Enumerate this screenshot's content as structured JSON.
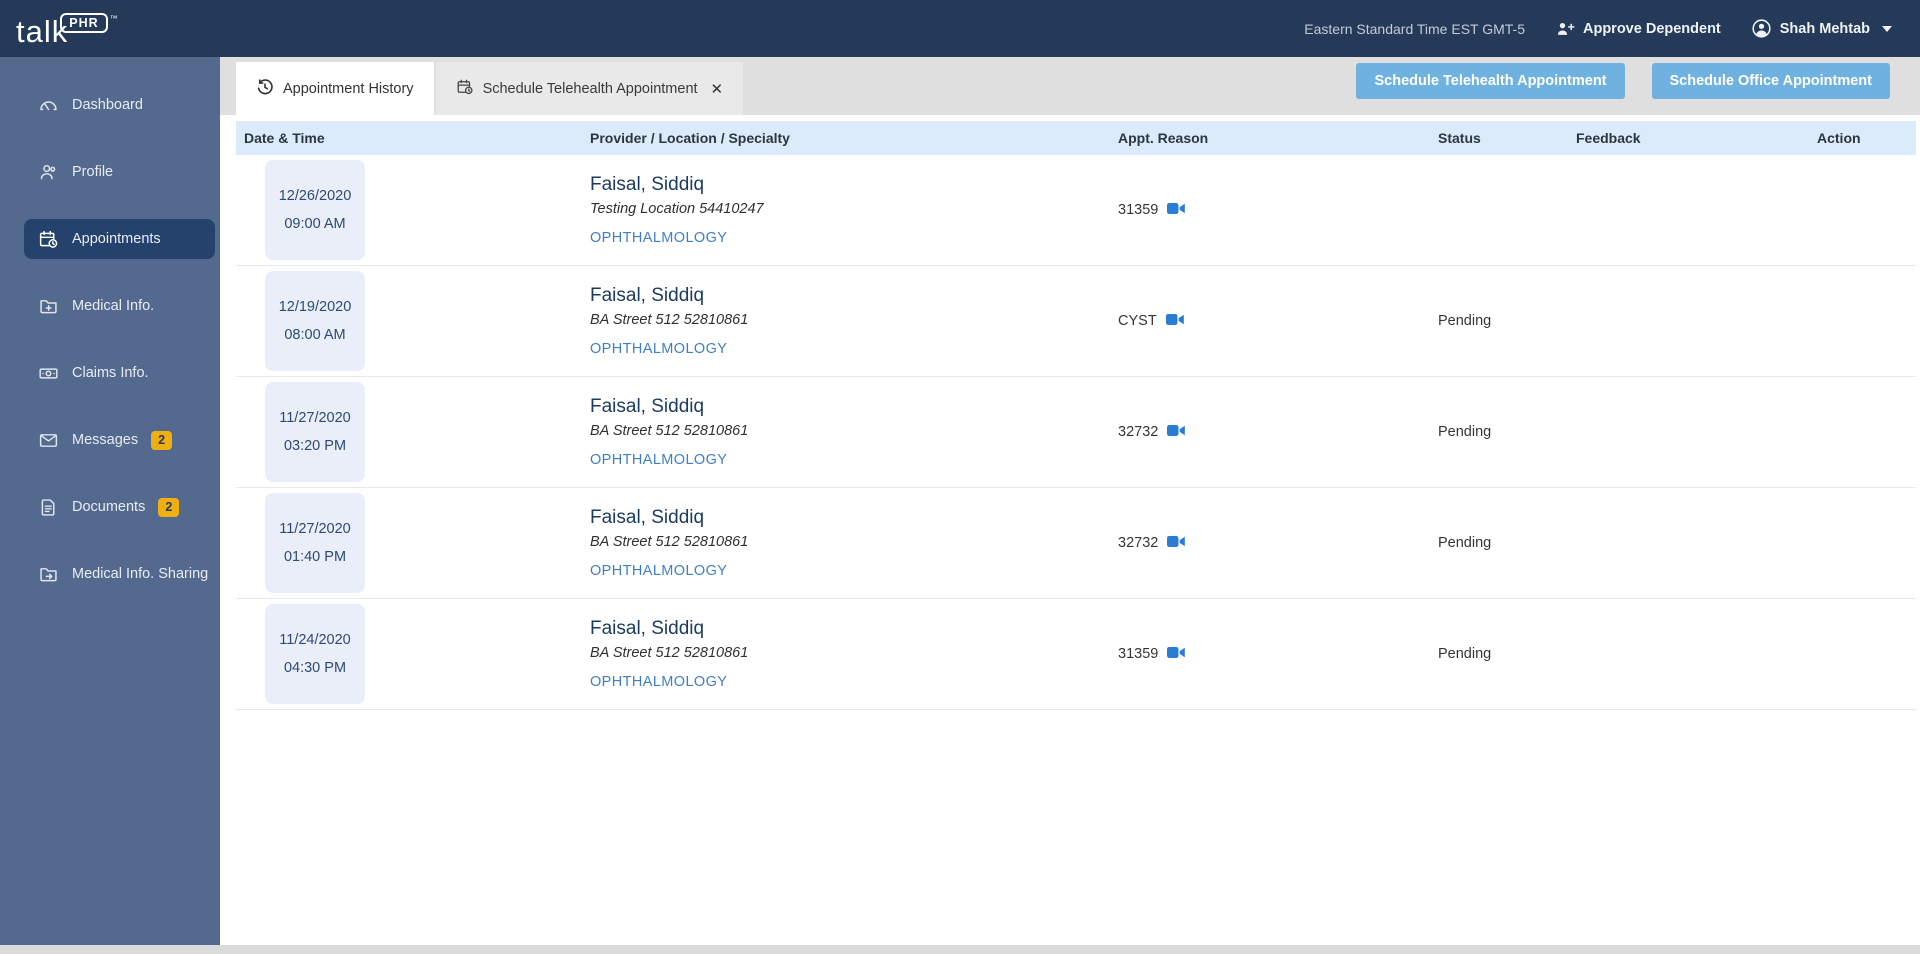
{
  "brand": {
    "name": "talk",
    "badge": "PHR",
    "tm": "™"
  },
  "topbar": {
    "timezone": "Eastern Standard Time EST GMT-5",
    "approve_dependent": "Approve Dependent",
    "user_name": "Shah Mehtab"
  },
  "sidebar": {
    "items": [
      {
        "label": "Dashboard",
        "icon": "dashboard-icon",
        "active": false
      },
      {
        "label": "Profile",
        "icon": "profile-icon",
        "active": false
      },
      {
        "label": "Appointments",
        "icon": "appointments-icon",
        "active": true
      },
      {
        "label": "Medical Info.",
        "icon": "medical-info-icon",
        "active": false
      },
      {
        "label": "Claims Info.",
        "icon": "claims-icon",
        "active": false
      },
      {
        "label": "Messages",
        "icon": "messages-icon",
        "active": false,
        "badge": "2"
      },
      {
        "label": "Documents",
        "icon": "documents-icon",
        "active": false,
        "badge": "2"
      },
      {
        "label": "Medical Info. Sharing",
        "icon": "sharing-icon",
        "active": false
      }
    ]
  },
  "tabs": {
    "history_label": "Appointment History",
    "schedule_label": "Schedule Telehealth Appointment",
    "close_glyph": "✕"
  },
  "actions": {
    "schedule_telehealth": "Schedule Telehealth Appointment",
    "schedule_office": "Schedule Office Appointment"
  },
  "table": {
    "headers": {
      "date": "Date & Time",
      "provider": "Provider / Location / Specialty",
      "reason": "Appt. Reason",
      "status": "Status",
      "feedback": "Feedback",
      "action": "Action"
    },
    "rows": [
      {
        "date": "12/26/2020",
        "time": "09:00 AM",
        "provider": "Faisal, Siddiq",
        "location": "Testing Location 54410247",
        "specialty": "OPHTHALMOLOGY",
        "reason": "31359",
        "status": "",
        "feedback": "",
        "action": ""
      },
      {
        "date": "12/19/2020",
        "time": "08:00 AM",
        "provider": "Faisal, Siddiq",
        "location": "BA Street 512 52810861",
        "specialty": "OPHTHALMOLOGY",
        "reason": "CYST",
        "status": "Pending",
        "feedback": "",
        "action": ""
      },
      {
        "date": "11/27/2020",
        "time": "03:20 PM",
        "provider": "Faisal, Siddiq",
        "location": "BA Street 512 52810861",
        "specialty": "OPHTHALMOLOGY",
        "reason": "32732",
        "status": "Pending",
        "feedback": "",
        "action": ""
      },
      {
        "date": "11/27/2020",
        "time": "01:40 PM",
        "provider": "Faisal, Siddiq",
        "location": "BA Street 512 52810861",
        "specialty": "OPHTHALMOLOGY",
        "reason": "32732",
        "status": "Pending",
        "feedback": "",
        "action": ""
      },
      {
        "date": "11/24/2020",
        "time": "04:30 PM",
        "provider": "Faisal, Siddiq",
        "location": "BA Street 512 52810861",
        "specialty": "OPHTHALMOLOGY",
        "reason": "31359",
        "status": "Pending",
        "feedback": "",
        "action": ""
      }
    ]
  },
  "colors": {
    "topbar": "#243A58",
    "sidebar": "#54698E",
    "active_item": "#24426B",
    "badge": "#EFAF10",
    "button": "#70B2DF",
    "header_row": "#DCEBFA",
    "date_chip": "#E9EEF9",
    "specialty_link": "#4080C0",
    "video_icon": "#2B7CD3"
  }
}
